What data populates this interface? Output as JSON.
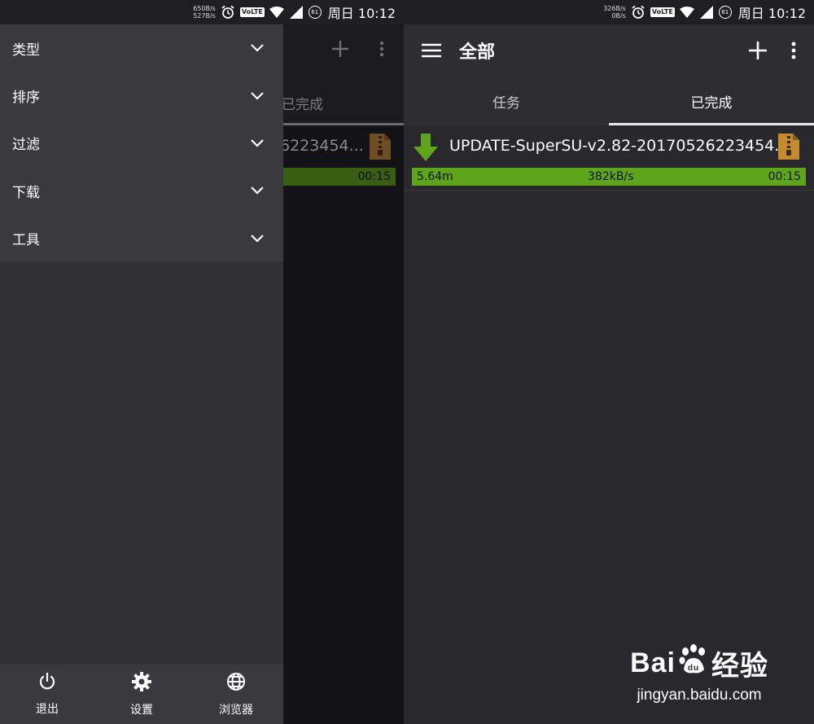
{
  "status_left": {
    "speed_up": "650B/s",
    "speed_down": "527B/s",
    "volte": "VoLTE",
    "battery": "61",
    "time": "周日 10:12"
  },
  "status_right": {
    "speed_up": "326B/s",
    "speed_down": "0B/s",
    "volte": "VoLTE",
    "battery": "61",
    "time": "周日 10:12"
  },
  "appbar": {
    "title": "全部"
  },
  "tabs": [
    {
      "label": "任务"
    },
    {
      "label": "已完成"
    }
  ],
  "download": {
    "name": "UPDATE-SuperSU-v2.82-20170526223454...",
    "size": "5.64m",
    "speed": "382kB/s",
    "time": "00:15"
  },
  "dim": {
    "tab": "已完成",
    "name_fragment": "6223454...",
    "time": "00:15"
  },
  "drawer": {
    "menu": [
      {
        "label": "类型"
      },
      {
        "label": "排序"
      },
      {
        "label": "过滤"
      },
      {
        "label": "下载"
      },
      {
        "label": "工具"
      }
    ],
    "bottom": [
      {
        "label": "退出",
        "icon": "power-icon"
      },
      {
        "label": "设置",
        "icon": "gear-icon"
      },
      {
        "label": "浏览器",
        "icon": "globe-icon"
      }
    ]
  },
  "watermark": {
    "brand_a": "Bai",
    "brand_b": "经验",
    "url": "jingyan.baidu.com"
  },
  "colors": {
    "progress": "#5fa51b",
    "background": "#29282d",
    "drawer": "#3a393e"
  }
}
